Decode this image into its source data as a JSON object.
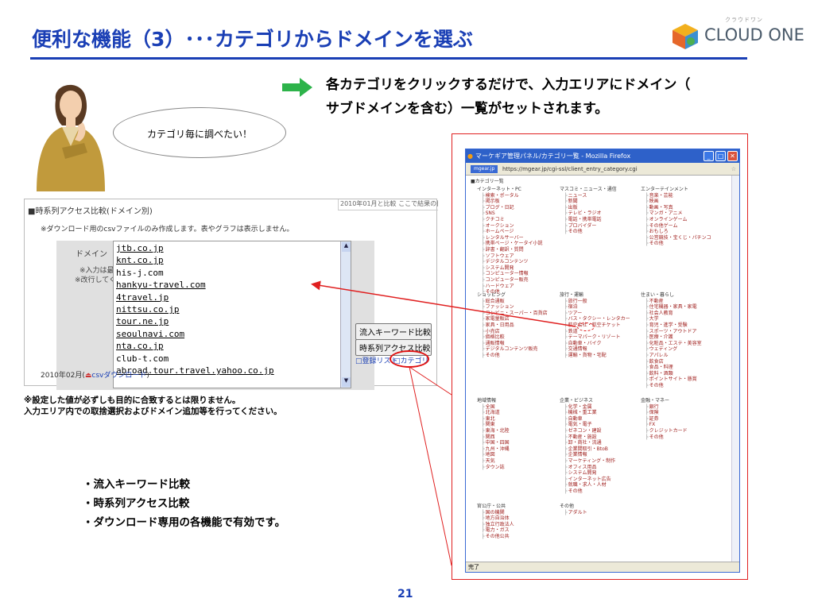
{
  "slide": {
    "title": "便利な機能（3）･･･カテゴリからドメインを選ぶ",
    "logo_small": "クラウドワン",
    "logo_text": "CLOUD ONE",
    "lead_line1": "各カテゴリをクリックするだけで、入力エリアにドメイン（",
    "lead_line2": "サブドメインを含む）一覧がセットされます。",
    "bubble": "カテゴリ毎に調べたい！",
    "caution_line1": "※設定した値が必ずしも目的に合致するとは限りません。",
    "caution_line2": "入力エリア内での取捨選択およびドメイン追加等を行ってください。",
    "bullets": [
      "・流入キーワード比較",
      "・時系列アクセス比較",
      "・ダウンロード専用の各機能で有効です。"
    ],
    "page_number": "21"
  },
  "colors": {
    "title": "#1a3fb5",
    "accent_red": "#e02020",
    "arrow_green": "#2db34a",
    "link_red": "#a0201e"
  },
  "left_panel": {
    "header": "■時系列アクセス比較(ドメイン別)",
    "header_right": "2010年01月と比較 ここで結果の比較",
    "note": "※ダウンロード用のcsvファイルのみ作成します。表やグラフは表示しません。",
    "domain_label": "ドメイン",
    "domain_note_1": "※入力は最大20件",
    "domain_note_2": "※改行してください",
    "domains": [
      {
        "text": "jtb.co.jp",
        "underline": true
      },
      {
        "text": "knt.co.jp",
        "underline": true
      },
      {
        "text": "his-j.com",
        "underline": false
      },
      {
        "text": "hankyu-travel.com",
        "underline": true
      },
      {
        "text": "4travel.jp",
        "underline": true
      },
      {
        "text": "nittsu.co.jp",
        "underline": true
      },
      {
        "text": "tour.ne.jp",
        "underline": true
      },
      {
        "text": "seoulnavi.com",
        "underline": true
      },
      {
        "text": "nta.co.jp",
        "underline": true
      },
      {
        "text": "club-t.com",
        "underline": false
      },
      {
        "text": "abroad.tour.travel.yahoo.co.jp",
        "underline": true
      }
    ],
    "btn_keyword": "流入キーワード比較",
    "btn_timeseries": "時系列アクセス比較",
    "link_list": "登録リスト",
    "link_category": "カテゴリ",
    "date_label": "2010年02月(",
    "csv_link": "csvダウンロード",
    "date_close": ")"
  },
  "browser": {
    "title": "マーケギア管理パネル/カテゴリ一覧 - Mozilla Firefox",
    "tab_label": "mgear.jp",
    "url": "https://mgear.jp/cgi-ssl/client_entry_category.cgi",
    "status": "完了",
    "root": "■カテゴリ一覧",
    "groups": [
      {
        "name": "インターネット・PC",
        "items": [
          "検索・ポータル",
          "掲示板",
          "ブログ・日記",
          "SNS",
          "クチコミ",
          "オークション",
          "ホームページ",
          "レンタルサーバー",
          "携帯ページ・ケータイ小説",
          "辞書・翻訳・質問",
          "ソフトウェア",
          "デジタルコンテンツ",
          "システム開発",
          "コンピューター情報",
          "コンピューター販売",
          "ハードウェア",
          "その他"
        ]
      },
      {
        "name": "マスコミ・ニュース・通信",
        "items": [
          "ニュース",
          "新聞",
          "出版",
          "テレビ・ラジオ",
          "電話・携帯電話",
          "プロバイダー",
          "その他"
        ]
      },
      {
        "name": "エンターテインメント",
        "items": [
          "音楽・芸能",
          "映画",
          "動画・写真",
          "マンガ・アニメ",
          "オンラインゲーム",
          "その他ゲーム",
          "おもしろ",
          "公営競技・宝くじ・パチンコ",
          "その他"
        ]
      },
      {
        "name": "ショッピング",
        "items": [
          "総合通販",
          "ファッション",
          "コンビニ・スーパー・百貨店",
          "家電量販店",
          "家具・日用品",
          "小売店",
          "価格比較",
          "通販情報",
          "デジタルコンテンツ販売",
          "その他"
        ]
      },
      {
        "name": "旅行・運輸",
        "items": [
          "旅行一般",
          "宿泊",
          "ツアー",
          "バス・タクシー・レンタカー",
          "航空会社・航空チケット",
          "鉄道",
          "テーマパーク・リゾート",
          "自動車・バイク",
          "交通情報",
          "運輸・貨物・宅配"
        ]
      },
      {
        "name": "住まい・暮らし",
        "items": [
          "不動産",
          "住宅機器・家具・家電",
          "社会人教育",
          "大学",
          "育児・進学・受験",
          "スポーツ・アウトドア",
          "医療・介護",
          "化粧品・エステ・美容室",
          "ウェディング",
          "アパレル",
          "飲食店",
          "食品・料理",
          "飲料・酒類",
          "ポイントサイト・懸賞",
          "その他"
        ]
      },
      {
        "name": "地域情報",
        "items": [
          "全国",
          "北海道",
          "東北",
          "関東",
          "東海・北陸",
          "関西",
          "中国・四国",
          "九州・沖縄",
          "地図",
          "天気",
          "タウン誌"
        ]
      },
      {
        "name": "企業・ビジネス",
        "items": [
          "化学・金属",
          "機械・重工業",
          "自動車",
          "電気・電子",
          "ゼネコン・建設",
          "不動産・施設",
          "卸・商社・流通",
          "企業間取引・BtoB",
          "企業情報",
          "マーケティング・制作",
          "オフィス用品",
          "システム開発",
          "インターネット広告",
          "就職・求人・人材",
          "その他"
        ]
      },
      {
        "name": "金融・マネー",
        "items": [
          "銀行",
          "保険",
          "証券",
          "FX",
          "クレジットカード",
          "その他"
        ]
      },
      {
        "name": "官公庁・公共",
        "items": [
          "国の機関",
          "地方自治体",
          "独立行政法人",
          "電力・ガス",
          "その他公共"
        ]
      },
      {
        "name": "その他",
        "items": [
          "アダルト"
        ]
      }
    ]
  }
}
